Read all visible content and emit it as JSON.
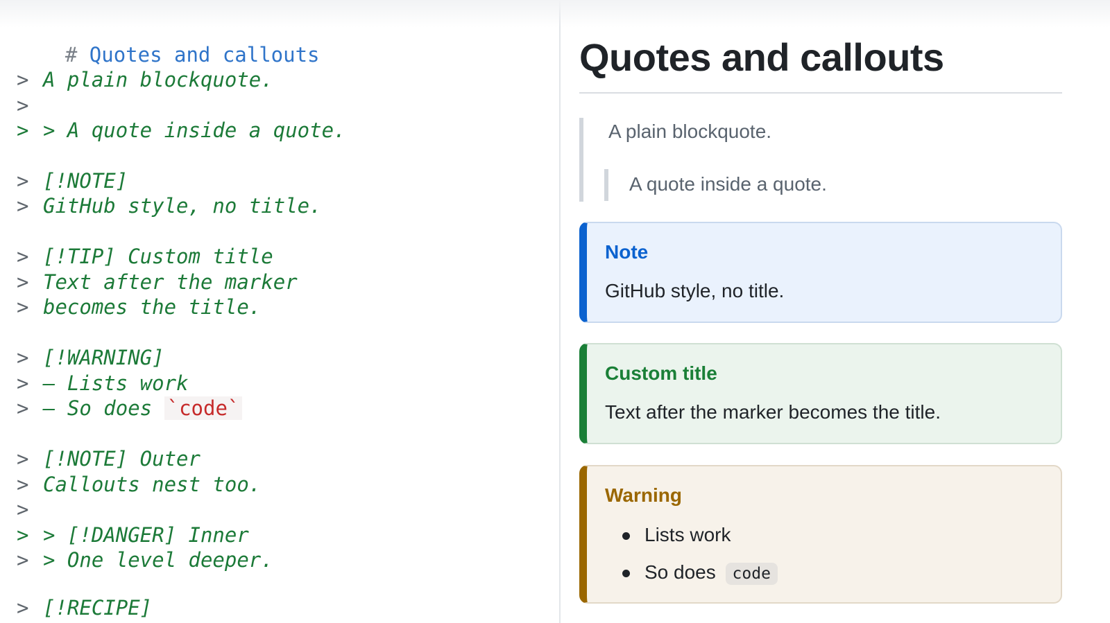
{
  "editor": {
    "heading": {
      "hash": "#",
      "text": "Quotes and callouts"
    },
    "lines": {
      "l1": {
        "marker": ">",
        "text": "A plain blockquote."
      },
      "l2": {
        "marker": ">",
        "text": ""
      },
      "l3": {
        "marker": ">",
        "text": "> A quote inside a quote."
      },
      "l4": {
        "marker": ">",
        "text": "[!NOTE]"
      },
      "l5": {
        "marker": ">",
        "text": "GitHub style, no title."
      },
      "l6": {
        "marker": ">",
        "text": "[!TIP] Custom title"
      },
      "l7": {
        "marker": ">",
        "text": "Text after the marker"
      },
      "l8": {
        "marker": ">",
        "text": "becomes the title."
      },
      "l9": {
        "marker": ">",
        "text": "[!WARNING]"
      },
      "l10": {
        "marker": ">",
        "text": "– Lists work"
      },
      "l11": {
        "marker": ">",
        "text": "– So does ",
        "code": "`code`"
      },
      "l12": {
        "marker": ">",
        "text": "[!NOTE] Outer"
      },
      "l13": {
        "marker": ">",
        "text": "Callouts nest too."
      },
      "l14": {
        "marker": ">",
        "text": ""
      },
      "l15": {
        "marker": ">",
        "text": "> [!DANGER] Inner"
      },
      "l16": {
        "marker": ">",
        "text": "> One level deeper."
      },
      "l17": {
        "marker": ">",
        "text": "[!RECIPE]"
      }
    }
  },
  "preview": {
    "title": "Quotes and callouts",
    "blockquote": {
      "text": "A plain blockquote.",
      "nested_text": "A quote inside a quote."
    },
    "callouts": {
      "note": {
        "title": "Note",
        "body": "GitHub style, no title."
      },
      "tip": {
        "title": "Custom title",
        "body": "Text after the marker becomes the title."
      },
      "warning": {
        "title": "Warning",
        "items": {
          "i1": "Lists work",
          "i2_text": "So does",
          "i2_code": "code"
        }
      }
    }
  },
  "colors": {
    "note_accent": "#0b62cf",
    "tip_accent": "#1a7f37",
    "warning_accent": "#9a6700",
    "editor_quote_green": "#1c7a38",
    "editor_heading_blue": "#2f74c9",
    "editor_code_red": "#c62a2a"
  }
}
